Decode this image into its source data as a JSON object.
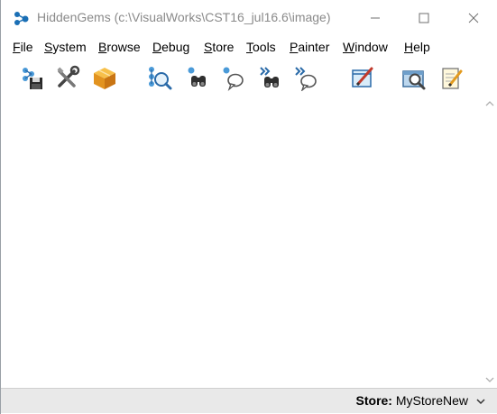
{
  "window": {
    "title": "HiddenGems (c:\\VisualWorks\\CST16_jul16.6\\image)"
  },
  "menu": {
    "items": [
      {
        "mnemonic": "F",
        "rest": "ile"
      },
      {
        "mnemonic": "S",
        "rest": "ystem"
      },
      {
        "mnemonic": "B",
        "rest": "rowse"
      },
      {
        "mnemonic": "D",
        "rest": "ebug"
      },
      {
        "mnemonic": "S",
        "rest": "tore"
      },
      {
        "mnemonic": "T",
        "rest": "ools"
      },
      {
        "mnemonic": "P",
        "rest": "ainter"
      },
      {
        "mnemonic": "W",
        "rest": "indow"
      },
      {
        "mnemonic": "H",
        "rest": "elp"
      }
    ]
  },
  "toolbar": {
    "icons": [
      "save-image-icon",
      "tools-icon",
      "package-icon",
      "class-browser-icon",
      "inspect-icon",
      "workspace-icon",
      "fast-inspect-icon",
      "fast-workspace-icon",
      "painter-icon",
      "finder-icon",
      "notepad-icon"
    ]
  },
  "statusbar": {
    "store_label": "Store:",
    "store_value": "MyStoreNew"
  },
  "colors": {
    "accent": "#1a6fb5",
    "statusbar_bg": "#e9e9e9"
  }
}
